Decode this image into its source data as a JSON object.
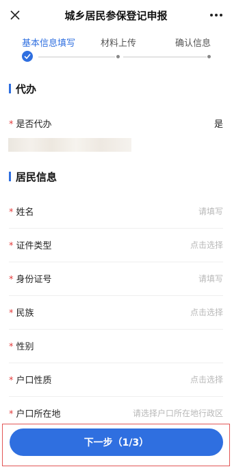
{
  "header": {
    "title": "城乡居民参保登记申报",
    "close_icon": "close-icon",
    "more_icon": "more-icon"
  },
  "steps": [
    {
      "label": "基本信息填写",
      "state": "active"
    },
    {
      "label": "材料上传",
      "state": "pending"
    },
    {
      "label": "确认信息",
      "state": "pending"
    }
  ],
  "agent_section": {
    "title": "代办",
    "row": {
      "label": "是否代办",
      "value": "是"
    }
  },
  "resident_section": {
    "title": "居民信息",
    "rows": [
      {
        "label": "姓名",
        "placeholder": "请填写"
      },
      {
        "label": "证件类型",
        "placeholder": "点击选择"
      },
      {
        "label": "身份证号",
        "placeholder": "请填写"
      },
      {
        "label": "民族",
        "placeholder": "点击选择"
      },
      {
        "label": "性别",
        "placeholder": ""
      },
      {
        "label": "户口性质",
        "placeholder": "点击选择"
      },
      {
        "label": "户口所在地",
        "placeholder": "请选择户口所在地行政区"
      }
    ]
  },
  "required_mark": "*",
  "footer": {
    "next_button": "下一步（1/3）"
  },
  "colors": {
    "accent": "#2f6fe0",
    "required": "#e23b3b",
    "outline": "#e25555"
  }
}
